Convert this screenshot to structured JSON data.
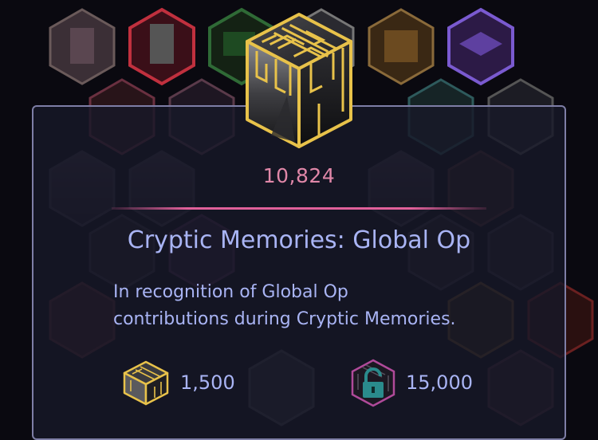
{
  "badge": {
    "count": "10,824",
    "title": "Cryptic Memories: Global Op",
    "description_line1": "In recognition of Global Op",
    "description_line2": "contributions during Cryptic Memories."
  },
  "rewards": [
    {
      "icon": "gold-cube-badge-icon",
      "value": "1,500"
    },
    {
      "icon": "locked-badge-icon",
      "value": "15,000"
    }
  ],
  "colors": {
    "background": "#0a0910",
    "panel_border": "#7e7ea6",
    "count_pink": "#e087a8",
    "divider_pink": "#e0609a",
    "text_lavender": "#a9b4f4",
    "gold": "#e8c24a",
    "lock_teal": "#2a8b8c"
  }
}
